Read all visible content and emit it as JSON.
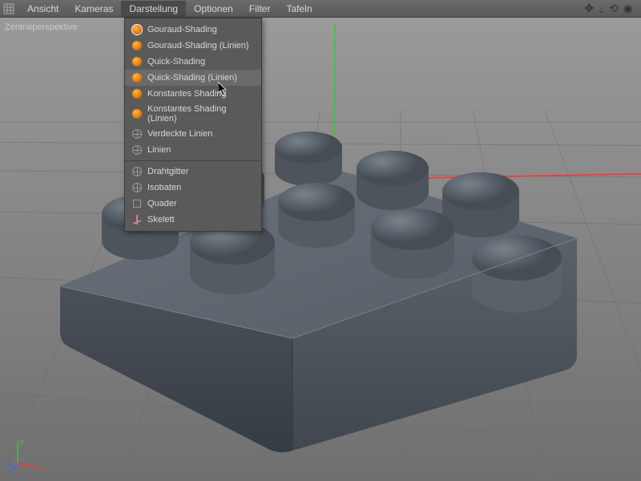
{
  "menubar": {
    "items": [
      "Ansicht",
      "Kameras",
      "Darstellung",
      "Optionen",
      "Filter",
      "Tafeln"
    ],
    "active_index": 2
  },
  "viewport_label": "Zentralperspektive",
  "dropdown": {
    "groups": [
      [
        {
          "label": "Gouraud-Shading",
          "icon": "sphere",
          "selected": true
        },
        {
          "label": "Gouraud-Shading (Linien)",
          "icon": "sphere"
        },
        {
          "label": "Quick-Shading",
          "icon": "sphere"
        },
        {
          "label": "Quick-Shading (Linien)",
          "icon": "sphere",
          "hover": true
        },
        {
          "label": "Konstantes Shading",
          "icon": "sphere"
        },
        {
          "label": "Konstantes Shading (Linien)",
          "icon": "sphere"
        },
        {
          "label": "Verdeckte Linien",
          "icon": "wire"
        },
        {
          "label": "Linien",
          "icon": "wire"
        }
      ],
      [
        {
          "label": "Drahtgitter",
          "icon": "wire"
        },
        {
          "label": "Isobaten",
          "icon": "wire"
        },
        {
          "label": "Quader",
          "icon": "box"
        },
        {
          "label": "Skelett",
          "icon": "skel"
        }
      ]
    ]
  },
  "axes": {
    "x": "x",
    "y": "y",
    "z": "z"
  }
}
